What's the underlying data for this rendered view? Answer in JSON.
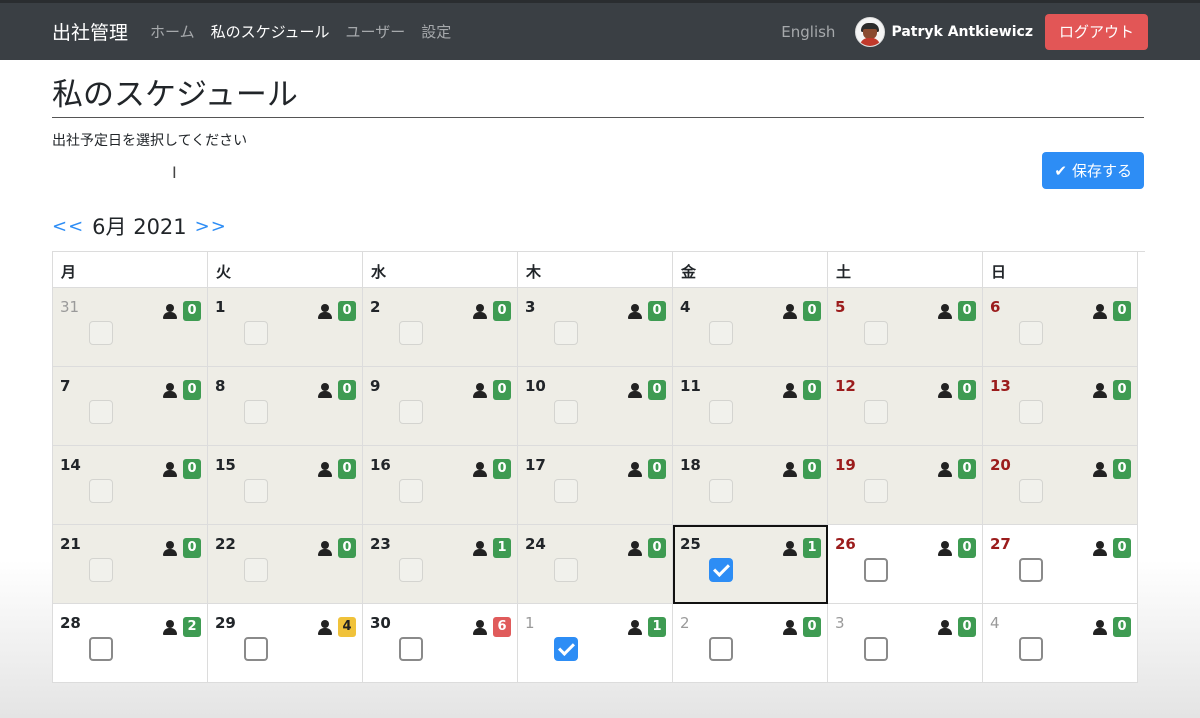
{
  "nav": {
    "brand": "出社管理",
    "links": [
      "ホーム",
      "私のスケジュール",
      "ユーザー",
      "設定"
    ],
    "active_index": 1,
    "language": "English",
    "user_name": "Patryk Antkiewicz",
    "logout": "ログアウト"
  },
  "page": {
    "title": "私のスケジュール",
    "instruction": "出社予定日を選択してください",
    "save_label": "保存する"
  },
  "month_nav": {
    "prev": "<<",
    "label": "6月 2021",
    "next": ">>"
  },
  "calendar": {
    "weekdays": [
      "月",
      "火",
      "水",
      "木",
      "金",
      "土",
      "日"
    ],
    "weeks": [
      [
        {
          "day": "31",
          "count": "0",
          "badge": "green",
          "state": "past",
          "other": true,
          "weekend": false,
          "checked": false
        },
        {
          "day": "1",
          "count": "0",
          "badge": "green",
          "state": "past",
          "other": false,
          "weekend": false,
          "checked": false
        },
        {
          "day": "2",
          "count": "0",
          "badge": "green",
          "state": "past",
          "other": false,
          "weekend": false,
          "checked": false
        },
        {
          "day": "3",
          "count": "0",
          "badge": "green",
          "state": "past",
          "other": false,
          "weekend": false,
          "checked": false
        },
        {
          "day": "4",
          "count": "0",
          "badge": "green",
          "state": "past",
          "other": false,
          "weekend": false,
          "checked": false
        },
        {
          "day": "5",
          "count": "0",
          "badge": "green",
          "state": "past",
          "other": false,
          "weekend": true,
          "checked": false
        },
        {
          "day": "6",
          "count": "0",
          "badge": "green",
          "state": "past",
          "other": false,
          "weekend": true,
          "checked": false
        }
      ],
      [
        {
          "day": "7",
          "count": "0",
          "badge": "green",
          "state": "past",
          "other": false,
          "weekend": false,
          "checked": false
        },
        {
          "day": "8",
          "count": "0",
          "badge": "green",
          "state": "past",
          "other": false,
          "weekend": false,
          "checked": false
        },
        {
          "day": "9",
          "count": "0",
          "badge": "green",
          "state": "past",
          "other": false,
          "weekend": false,
          "checked": false
        },
        {
          "day": "10",
          "count": "0",
          "badge": "green",
          "state": "past",
          "other": false,
          "weekend": false,
          "checked": false
        },
        {
          "day": "11",
          "count": "0",
          "badge": "green",
          "state": "past",
          "other": false,
          "weekend": false,
          "checked": false
        },
        {
          "day": "12",
          "count": "0",
          "badge": "green",
          "state": "past",
          "other": false,
          "weekend": true,
          "checked": false
        },
        {
          "day": "13",
          "count": "0",
          "badge": "green",
          "state": "past",
          "other": false,
          "weekend": true,
          "checked": false
        }
      ],
      [
        {
          "day": "14",
          "count": "0",
          "badge": "green",
          "state": "past",
          "other": false,
          "weekend": false,
          "checked": false
        },
        {
          "day": "15",
          "count": "0",
          "badge": "green",
          "state": "past",
          "other": false,
          "weekend": false,
          "checked": false
        },
        {
          "day": "16",
          "count": "0",
          "badge": "green",
          "state": "past",
          "other": false,
          "weekend": false,
          "checked": false
        },
        {
          "day": "17",
          "count": "0",
          "badge": "green",
          "state": "past",
          "other": false,
          "weekend": false,
          "checked": false
        },
        {
          "day": "18",
          "count": "0",
          "badge": "green",
          "state": "past",
          "other": false,
          "weekend": false,
          "checked": false
        },
        {
          "day": "19",
          "count": "0",
          "badge": "green",
          "state": "past",
          "other": false,
          "weekend": true,
          "checked": false
        },
        {
          "day": "20",
          "count": "0",
          "badge": "green",
          "state": "past",
          "other": false,
          "weekend": true,
          "checked": false
        }
      ],
      [
        {
          "day": "21",
          "count": "0",
          "badge": "green",
          "state": "past",
          "other": false,
          "weekend": false,
          "checked": false
        },
        {
          "day": "22",
          "count": "0",
          "badge": "green",
          "state": "past",
          "other": false,
          "weekend": false,
          "checked": false
        },
        {
          "day": "23",
          "count": "1",
          "badge": "green",
          "state": "past",
          "other": false,
          "weekend": false,
          "checked": false
        },
        {
          "day": "24",
          "count": "0",
          "badge": "green",
          "state": "past",
          "other": false,
          "weekend": false,
          "checked": false
        },
        {
          "day": "25",
          "count": "1",
          "badge": "green",
          "state": "today",
          "other": false,
          "weekend": false,
          "checked": true
        },
        {
          "day": "26",
          "count": "0",
          "badge": "green",
          "state": "future",
          "other": false,
          "weekend": true,
          "checked": false
        },
        {
          "day": "27",
          "count": "0",
          "badge": "green",
          "state": "future",
          "other": false,
          "weekend": true,
          "checked": false
        }
      ],
      [
        {
          "day": "28",
          "count": "2",
          "badge": "green",
          "state": "future",
          "other": false,
          "weekend": false,
          "checked": false
        },
        {
          "day": "29",
          "count": "4",
          "badge": "yellow",
          "state": "future",
          "other": false,
          "weekend": false,
          "checked": false
        },
        {
          "day": "30",
          "count": "6",
          "badge": "red",
          "state": "future",
          "other": false,
          "weekend": false,
          "checked": false
        },
        {
          "day": "1",
          "count": "1",
          "badge": "green",
          "state": "future",
          "other": true,
          "weekend": false,
          "checked": true
        },
        {
          "day": "2",
          "count": "0",
          "badge": "green",
          "state": "future",
          "other": true,
          "weekend": false,
          "checked": false
        },
        {
          "day": "3",
          "count": "0",
          "badge": "green",
          "state": "future",
          "other": true,
          "weekend": false,
          "checked": false
        },
        {
          "day": "4",
          "count": "0",
          "badge": "green",
          "state": "future",
          "other": true,
          "weekend": false,
          "checked": false
        }
      ]
    ]
  },
  "colors": {
    "navbar": "#3a3f44",
    "logout": "#e25656",
    "primary": "#2d8df5",
    "badge_green": "#3e9b52",
    "badge_yellow": "#f0c23a",
    "badge_red": "#e05b5b",
    "weekend_text": "#9b1c1c",
    "past_cell": "#eeede6"
  },
  "icons": [
    "person-icon",
    "check-icon",
    "text-cursor-icon"
  ]
}
